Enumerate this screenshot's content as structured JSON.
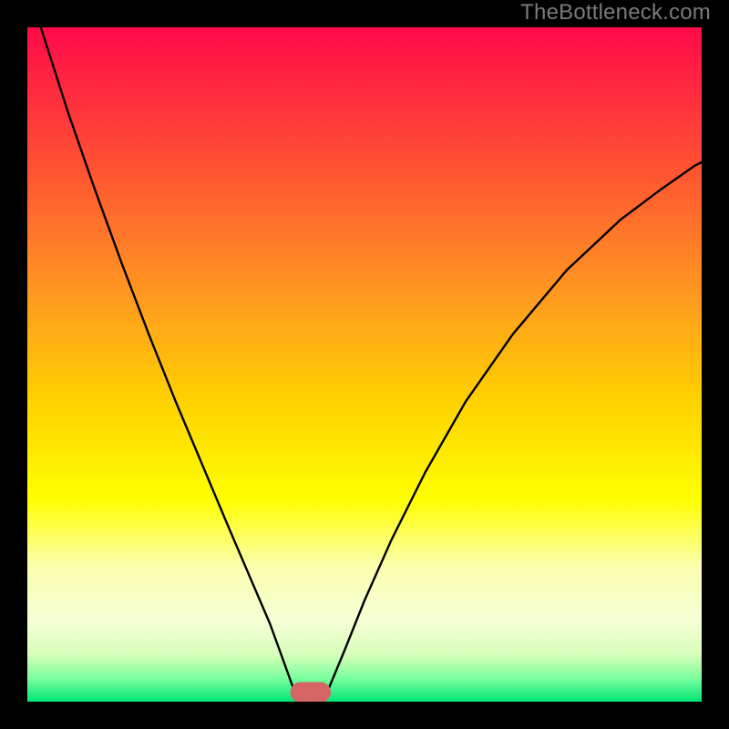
{
  "domain": "Chart",
  "watermark": "TheBottleneck.com",
  "colors": {
    "page_bg": "#000000",
    "watermark_text": "#7a7a7a",
    "gradient_stops": [
      {
        "offset": 0.0,
        "color": "#ff0a49"
      },
      {
        "offset": 0.2,
        "color": "#ff4f33"
      },
      {
        "offset": 0.4,
        "color": "#ff9a20"
      },
      {
        "offset": 0.55,
        "color": "#ffd000"
      },
      {
        "offset": 0.7,
        "color": "#ffff00"
      },
      {
        "offset": 0.8,
        "color": "#faffaf"
      },
      {
        "offset": 0.88,
        "color": "#f6ffd6"
      },
      {
        "offset": 0.93,
        "color": "#d7ffba"
      },
      {
        "offset": 0.965,
        "color": "#7bff9d"
      },
      {
        "offset": 1.0,
        "color": "#00e676"
      }
    ],
    "curve_stroke": "#000000",
    "marker_fill": "#d66565"
  },
  "chart_data": {
    "type": "line",
    "title": "",
    "xlabel": "",
    "ylabel": "",
    "xlim": [
      0,
      1
    ],
    "ylim": [
      0,
      1
    ],
    "annotations": [],
    "legend": [],
    "series": [
      {
        "name": "left-branch",
        "x": [
          0.02,
          0.06,
          0.1,
          0.14,
          0.18,
          0.22,
          0.26,
          0.3,
          0.33,
          0.36,
          0.38,
          0.398,
          0.4
        ],
        "values": [
          1.0,
          0.875,
          0.76,
          0.65,
          0.545,
          0.445,
          0.35,
          0.255,
          0.185,
          0.115,
          0.06,
          0.01,
          0.0
        ]
      },
      {
        "name": "right-branch",
        "x": [
          0.44,
          0.445,
          0.47,
          0.5,
          0.54,
          0.59,
          0.65,
          0.72,
          0.8,
          0.88,
          0.94,
          0.99,
          1.0
        ],
        "values": [
          0.0,
          0.015,
          0.075,
          0.15,
          0.24,
          0.34,
          0.445,
          0.545,
          0.64,
          0.715,
          0.76,
          0.795,
          0.8
        ]
      }
    ],
    "marker": {
      "name": "bottleneck-marker",
      "x_center": 0.42,
      "y_center": 0.014,
      "width": 0.06,
      "height": 0.03,
      "rx": 0.015
    }
  }
}
